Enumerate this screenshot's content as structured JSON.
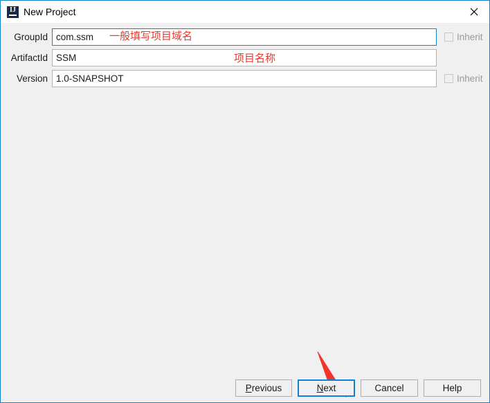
{
  "window": {
    "title": "New Project",
    "app_icon": "intellij-idea-icon",
    "icon_letters": "IJ",
    "close_icon": "close-icon",
    "border_color": "#1382ce",
    "background": "#f0f0f0"
  },
  "form": {
    "fields": [
      {
        "label": "GroupId",
        "value": "com.ssm",
        "focused": true,
        "has_inherit": true,
        "inherit_label": "Inherit",
        "inherit_checked": false
      },
      {
        "label": "ArtifactId",
        "value": "SSM",
        "focused": false,
        "has_inherit": false,
        "inherit_label": "",
        "inherit_checked": false
      },
      {
        "label": "Version",
        "value": "1.0-SNAPSHOT",
        "focused": false,
        "has_inherit": true,
        "inherit_label": "Inherit",
        "inherit_checked": false
      }
    ]
  },
  "annotations": {
    "color": "#e8392e",
    "groupid_note": "一般填写项目域名",
    "artifactid_note": "项目名称",
    "arrow": "red-arrow-pointing-to-next-button"
  },
  "buttons": {
    "previous": {
      "label": "Previous",
      "mnemonic": "P",
      "default": false
    },
    "next": {
      "label": "Next",
      "mnemonic": "N",
      "default": true
    },
    "cancel": {
      "label": "Cancel",
      "mnemonic": "",
      "default": false
    },
    "help": {
      "label": "Help",
      "mnemonic": "",
      "default": false
    }
  }
}
